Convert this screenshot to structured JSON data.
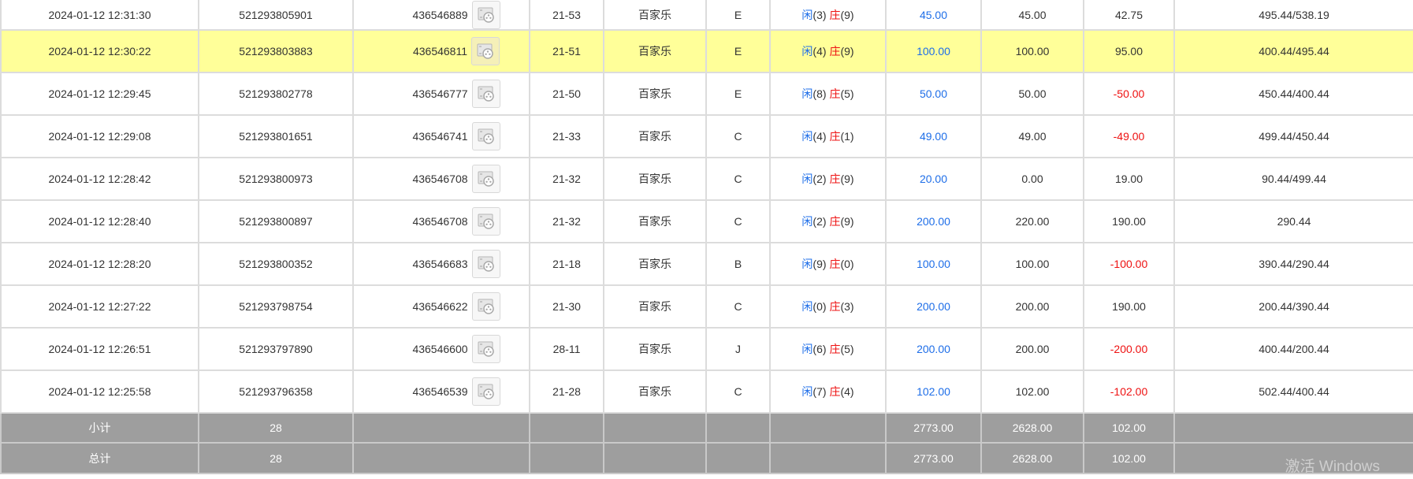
{
  "rows": [
    {
      "time": "2024-01-12 12:31:30",
      "bet_id": "521293805901",
      "round_id": "436546889",
      "table": "21-53",
      "game": "百家乐",
      "room": "E",
      "result": {
        "player_label": "闲",
        "player": "(3)",
        "banker_label": "庄",
        "banker": "(9)"
      },
      "bet": "45.00",
      "valid": "45.00",
      "win": "42.75",
      "balance": "495.44/538.19",
      "highlight": false,
      "win_negative": false
    },
    {
      "time": "2024-01-12 12:30:22",
      "bet_id": "521293803883",
      "round_id": "436546811",
      "table": "21-51",
      "game": "百家乐",
      "room": "E",
      "result": {
        "player_label": "闲",
        "player": "(4)",
        "banker_label": "庄",
        "banker": "(9)"
      },
      "bet": "100.00",
      "valid": "100.00",
      "win": "95.00",
      "balance": "400.44/495.44",
      "highlight": true,
      "win_negative": false
    },
    {
      "time": "2024-01-12 12:29:45",
      "bet_id": "521293802778",
      "round_id": "436546777",
      "table": "21-50",
      "game": "百家乐",
      "room": "E",
      "result": {
        "player_label": "闲",
        "player": "(8)",
        "banker_label": "庄",
        "banker": "(5)"
      },
      "bet": "50.00",
      "valid": "50.00",
      "win": "-50.00",
      "balance": "450.44/400.44",
      "highlight": false,
      "win_negative": true
    },
    {
      "time": "2024-01-12 12:29:08",
      "bet_id": "521293801651",
      "round_id": "436546741",
      "table": "21-33",
      "game": "百家乐",
      "room": "C",
      "result": {
        "player_label": "闲",
        "player": "(4)",
        "banker_label": "庄",
        "banker": "(1)"
      },
      "bet": "49.00",
      "valid": "49.00",
      "win": "-49.00",
      "balance": "499.44/450.44",
      "highlight": false,
      "win_negative": true
    },
    {
      "time": "2024-01-12 12:28:42",
      "bet_id": "521293800973",
      "round_id": "436546708",
      "table": "21-32",
      "game": "百家乐",
      "room": "C",
      "result": {
        "player_label": "闲",
        "player": "(2)",
        "banker_label": "庄",
        "banker": "(9)"
      },
      "bet": "20.00",
      "valid": "0.00",
      "win": "19.00",
      "balance": "90.44/499.44",
      "highlight": false,
      "win_negative": false
    },
    {
      "time": "2024-01-12 12:28:40",
      "bet_id": "521293800897",
      "round_id": "436546708",
      "table": "21-32",
      "game": "百家乐",
      "room": "C",
      "result": {
        "player_label": "闲",
        "player": "(2)",
        "banker_label": "庄",
        "banker": "(9)"
      },
      "bet": "200.00",
      "valid": "220.00",
      "win": "190.00",
      "balance": "290.44",
      "highlight": false,
      "win_negative": false
    },
    {
      "time": "2024-01-12 12:28:20",
      "bet_id": "521293800352",
      "round_id": "436546683",
      "table": "21-18",
      "game": "百家乐",
      "room": "B",
      "result": {
        "player_label": "闲",
        "player": "(9)",
        "banker_label": "庄",
        "banker": "(0)"
      },
      "bet": "100.00",
      "valid": "100.00",
      "win": "-100.00",
      "balance": "390.44/290.44",
      "highlight": false,
      "win_negative": true
    },
    {
      "time": "2024-01-12 12:27:22",
      "bet_id": "521293798754",
      "round_id": "436546622",
      "table": "21-30",
      "game": "百家乐",
      "room": "C",
      "result": {
        "player_label": "闲",
        "player": "(0)",
        "banker_label": "庄",
        "banker": "(3)"
      },
      "bet": "200.00",
      "valid": "200.00",
      "win": "190.00",
      "balance": "200.44/390.44",
      "highlight": false,
      "win_negative": false
    },
    {
      "time": "2024-01-12 12:26:51",
      "bet_id": "521293797890",
      "round_id": "436546600",
      "table": "28-11",
      "game": "百家乐",
      "room": "J",
      "result": {
        "player_label": "闲",
        "player": "(6)",
        "banker_label": "庄",
        "banker": "(5)"
      },
      "bet": "200.00",
      "valid": "200.00",
      "win": "-200.00",
      "balance": "400.44/200.44",
      "highlight": false,
      "win_negative": true
    },
    {
      "time": "2024-01-12 12:25:58",
      "bet_id": "521293796358",
      "round_id": "436546539",
      "table": "21-28",
      "game": "百家乐",
      "room": "C",
      "result": {
        "player_label": "闲",
        "player": "(7)",
        "banker_label": "庄",
        "banker": "(4)"
      },
      "bet": "102.00",
      "valid": "102.00",
      "win": "-102.00",
      "balance": "502.44/400.44",
      "highlight": false,
      "win_negative": true
    }
  ],
  "summary": {
    "subtotal": {
      "label": "小计",
      "count": "28",
      "bet": "2773.00",
      "valid": "2628.00",
      "win": "102.00"
    },
    "total": {
      "label": "总计",
      "count": "28",
      "bet": "2773.00",
      "valid": "2628.00",
      "win": "102.00"
    }
  },
  "video_icon_name": "film-reel-icon",
  "watermark": "激活 Windows",
  "colors": {
    "highlight": "#ffff99",
    "blue": "#1e6ee8",
    "red": "#ee1111",
    "summary_bg": "#9e9e9e"
  }
}
